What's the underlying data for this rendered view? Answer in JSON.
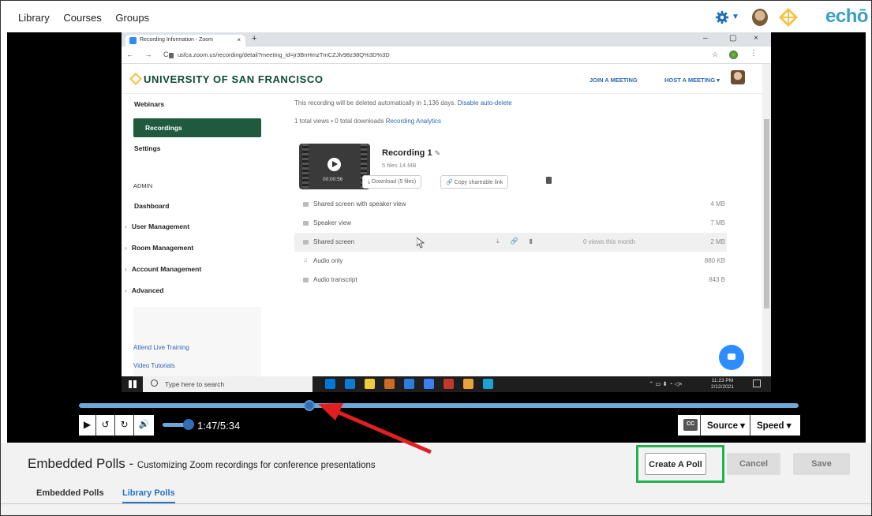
{
  "topbar": {
    "nav": [
      "Library",
      "Courses",
      "Groups"
    ],
    "brand": "echō",
    "icons": [
      "gear-icon",
      "user-avatar",
      "usf-logo"
    ]
  },
  "browser": {
    "tab_title": "Recording Information - Zoom",
    "tab_close": "×",
    "new_tab": "+",
    "url": "usfca.zoom.us/recording/detail?meeting_id=jr3BnHmzTmCZJlv98z38Q%3D%3D",
    "window_controls": [
      "–",
      "▢",
      "×"
    ]
  },
  "site": {
    "university": "UNIVERSITY OF SAN FRANCISCO",
    "join": "JOIN A MEETING",
    "host": "HOST A MEETING ▾"
  },
  "sidebar": {
    "items": [
      "Webinars",
      "Recordings",
      "Settings"
    ],
    "active": "Recordings",
    "admin_heading": "ADMIN",
    "admin_items": [
      "Dashboard",
      "User Management",
      "Room Management",
      "Account Management",
      "Advanced"
    ],
    "help_links": [
      "Attend Live Training",
      "Video Tutorials"
    ]
  },
  "recording": {
    "delete_notice": "This recording will be deleted automatically in 1,136 days.",
    "disable_link": "Disable auto-delete",
    "views": "1 total views • 0 total downloads",
    "analytics_link": "Recording Analytics",
    "name": "Recording 1",
    "meta": "5 files  14 MB",
    "duration": "00:00:56",
    "download_btn": "⤓  Download (5 files)",
    "copy_btn": "🔗  Copy shareable link",
    "files": [
      {
        "name": "Shared screen with speaker view",
        "size": "4 MB"
      },
      {
        "name": "Speaker view",
        "size": "7 MB"
      },
      {
        "name": "Shared screen",
        "size": "2 MB",
        "views": "0 views this month"
      },
      {
        "name": "Audio only",
        "size": "880 KB"
      },
      {
        "name": "Audio transcript",
        "size": "843 B"
      }
    ]
  },
  "taskbar": {
    "search_placeholder": "Type here to search",
    "time": "11:23 PM",
    "date": "2/12/2021",
    "app_colors": [
      "#0078d7",
      "#0a7bd6",
      "#f0c93d",
      "#c86b25",
      "#2b7de0",
      "#3c7ff1",
      "#c0392b",
      "#e9a23b",
      "#1ea1d6"
    ]
  },
  "player": {
    "position_fraction": 0.32,
    "time_display": "1:47/5:34",
    "volume_fraction": 1.0,
    "cc_label": "CC",
    "source_label": "Source ▾",
    "speed_label": "Speed ▾",
    "buttons": [
      "▶",
      "↺",
      "↻",
      "🔊"
    ]
  },
  "editor": {
    "title": "Embedded Polls -",
    "subtitle": "Customizing Zoom recordings for conference presentations",
    "create_poll": "Create A Poll",
    "cancel": "Cancel",
    "save": "Save",
    "tabs": [
      "Embedded Polls",
      "Library Polls"
    ],
    "active_tab": "Library Polls"
  },
  "colors": {
    "accent": "#2874c1",
    "usf_green": "#1f5a3e",
    "highlight_box": "#21b14f",
    "annotation_arrow": "#e02020"
  }
}
